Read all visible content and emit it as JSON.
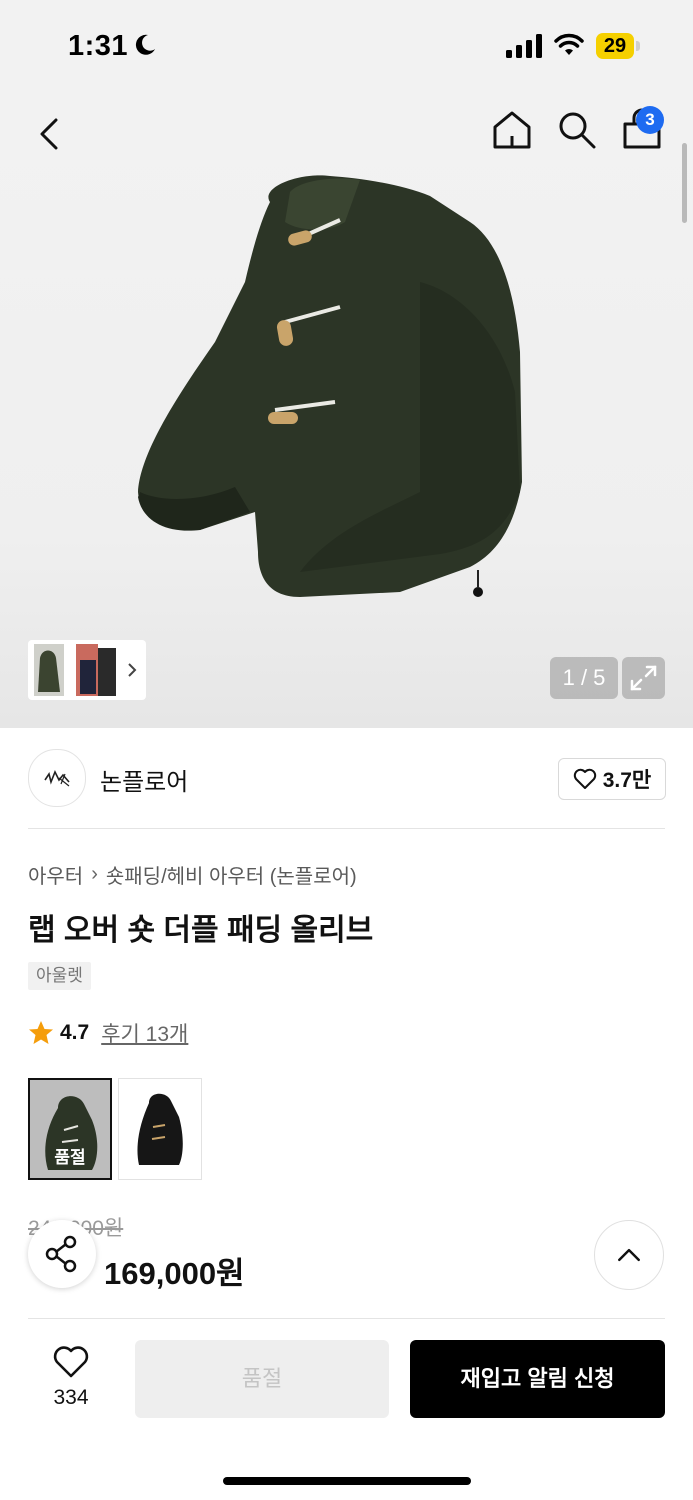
{
  "status_bar": {
    "time": "1:31",
    "battery": "29"
  },
  "header": {
    "cart_count": "3"
  },
  "gallery": {
    "counter": "1 / 5"
  },
  "brand": {
    "name": "논플로어",
    "likes": "3.7만"
  },
  "breadcrumb": {
    "category": "아우터",
    "subcategory": "숏패딩/헤비 아우터 (논플로어)"
  },
  "product": {
    "title": "랩 오버 숏 더플 패딩 올리브",
    "tag": "아울렛",
    "rating": "4.7",
    "review_link": "후기 13개",
    "original_price": "240,000원",
    "sale_price": "169,000원",
    "options": [
      {
        "label": "품절",
        "selected": true
      },
      {
        "label": "",
        "selected": false
      }
    ]
  },
  "bottom_bar": {
    "wish_count": "334",
    "soldout_label": "품절",
    "restock_label": "재입고 알림 신청"
  },
  "colors": {
    "accent_blue": "#1e6bf1",
    "jacket_olive": "#2c3526",
    "star": "#f59d0b"
  }
}
